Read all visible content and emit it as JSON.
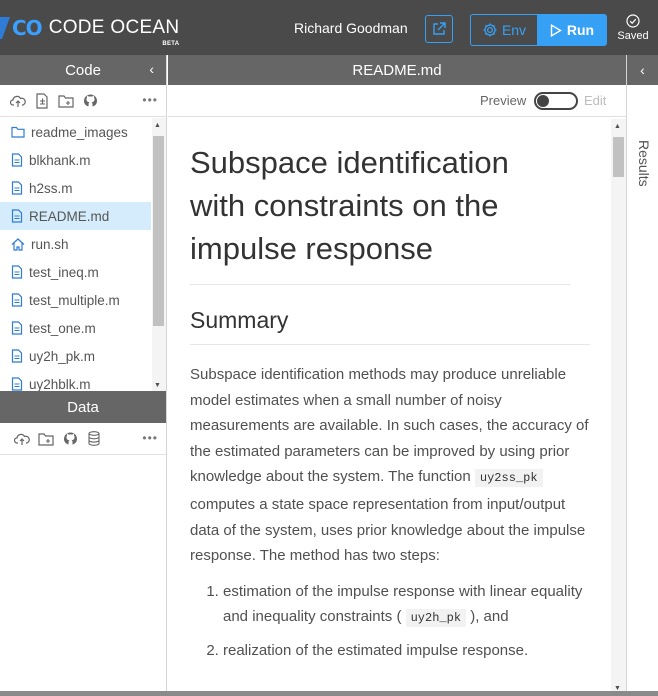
{
  "header": {
    "logo_mark": "CO",
    "logo_text": "CODE OCEAN",
    "logo_beta": "BETA",
    "user_name": "Richard Goodman",
    "env_label": "Env",
    "run_label": "Run",
    "saved_label": "Saved"
  },
  "code_panel": {
    "title": "Code",
    "files": [
      {
        "name": "readme_images",
        "icon": "folder-icon"
      },
      {
        "name": "blkhank.m",
        "icon": "file-icon"
      },
      {
        "name": "h2ss.m",
        "icon": "file-icon"
      },
      {
        "name": "README.md",
        "icon": "file-icon",
        "selected": true
      },
      {
        "name": "run.sh",
        "icon": "home-icon"
      },
      {
        "name": "test_ineq.m",
        "icon": "file-icon"
      },
      {
        "name": "test_multiple.m",
        "icon": "file-icon"
      },
      {
        "name": "test_one.m",
        "icon": "file-icon"
      },
      {
        "name": "uy2h_pk.m",
        "icon": "file-icon"
      },
      {
        "name": "uy2hblk.m",
        "icon": "file-icon"
      }
    ]
  },
  "data_panel": {
    "title": "Data"
  },
  "editor": {
    "tab_title": "README.md",
    "preview_label": "Preview",
    "edit_label": "Edit",
    "doc": {
      "title": "Subspace identification with constraints on the impulse response",
      "summary_heading": "Summary",
      "para_1": "Subspace identification methods may produce unreliable model estimates when a small number of noisy measurements are available. In such cases, the accuracy of the estimated parameters can be improved by using prior knowledge about the system. The function",
      "code_1": "uy2ss_pk",
      "para_2": "computes a state space representation from input/output data of the system, uses prior knowledge about the impulse response. The method has two steps:",
      "step_1_text": "estimation of the impulse response with linear equality and inequality constraints (",
      "step_1_code": "uy2h_pk",
      "step_1_end": "), and",
      "step_2_text": "realization of the estimated impulse response."
    }
  },
  "results_panel": {
    "title": "Results"
  },
  "colors": {
    "accent": "#36a0f5",
    "topbar": "#4a4a4a",
    "panel_header": "#666666",
    "selected_row": "#d4ecfb"
  }
}
